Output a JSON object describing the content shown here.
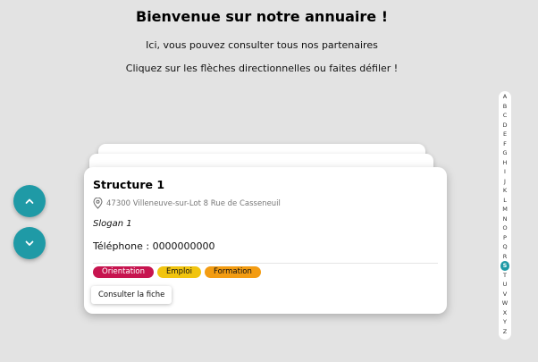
{
  "header": {
    "title": "Bienvenue sur notre annuaire !",
    "subtitle1": "Ici, vous pouvez consulter tous nos partenaires",
    "subtitle2": "Cliquez sur les flèches directionnelles ou faites défiler !"
  },
  "nav": {
    "up_icon": "chevron-up-icon",
    "down_icon": "chevron-down-icon",
    "color": "#1f9aa6"
  },
  "card": {
    "title": "Structure 1",
    "address_icon": "location-pin-icon",
    "address": "47300 Villeneuve-sur-Lot 8 Rue de Casseneuil",
    "slogan": "Slogan 1",
    "phone": "Téléphone : 0000000000",
    "tags": [
      {
        "label": "Orientation",
        "color": "#c7144f"
      },
      {
        "label": "Emploi",
        "color": "#f1c40f"
      },
      {
        "label": "Formation",
        "color": "#f39c12"
      }
    ],
    "button_label": "Consulter la fiche"
  },
  "alphabet": {
    "letters": [
      "A",
      "B",
      "C",
      "D",
      "E",
      "F",
      "G",
      "H",
      "I",
      "J",
      "K",
      "L",
      "M",
      "N",
      "O",
      "P",
      "Q",
      "R",
      "S",
      "T",
      "U",
      "V",
      "W",
      "X",
      "Y",
      "Z"
    ],
    "active": "S"
  }
}
